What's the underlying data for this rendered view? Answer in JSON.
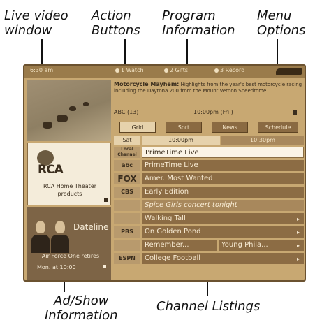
{
  "callouts": {
    "live_video": [
      "Live video",
      "window"
    ],
    "action_buttons": [
      "Action",
      "Buttons"
    ],
    "program_info": [
      "Program",
      "Information"
    ],
    "menu_options": [
      "Menu",
      "Options"
    ],
    "ad_show": [
      "Ad/Show",
      "Information"
    ],
    "channel_listings": "Channel Listings"
  },
  "screen": {
    "topbar": {
      "left_text": "6:30 am",
      "watch": "1 Watch",
      "gifts": "2 Gifts",
      "record": "3 Record"
    },
    "program_info": {
      "title": "Motorcycle Mayhem:",
      "text": "Highlights from the year's best motorcycle racing including the Daytona 200 from the Mount Vernon Speedrome."
    },
    "channel_row": {
      "left": "ABC (13)",
      "mid": "10:00pm (Fri.)"
    },
    "tabs": [
      "Grid",
      "Sort",
      "News",
      "Schedule"
    ],
    "time_row": [
      "Sat",
      "10:00pm",
      "10:30pm"
    ],
    "ad": {
      "logo": "RCA",
      "text": "RCA Home Theater products"
    },
    "show": {
      "name": "Dateline",
      "line1": "Air Force One retires",
      "line2": "Mon. at 10:00"
    },
    "listings": [
      {
        "logo": "Local Channel",
        "program": "PrimeTime Live"
      },
      {
        "logo": "abc",
        "program": "PrimeTime Live"
      },
      {
        "logo": "FOX",
        "program": "Amer. Most Wanted"
      },
      {
        "logo": "CBS",
        "program": "Early Edition"
      },
      {
        "logo": "",
        "program": "Spice Girls concert tonight"
      },
      {
        "logo": "",
        "program": "Walking Tall"
      },
      {
        "logo": "PBS",
        "program": "On Golden Pond"
      },
      {
        "logo": "",
        "program": "Remember...",
        "program2": "Young Phila..."
      },
      {
        "logo": "ESPN",
        "program": "College Football"
      }
    ]
  }
}
